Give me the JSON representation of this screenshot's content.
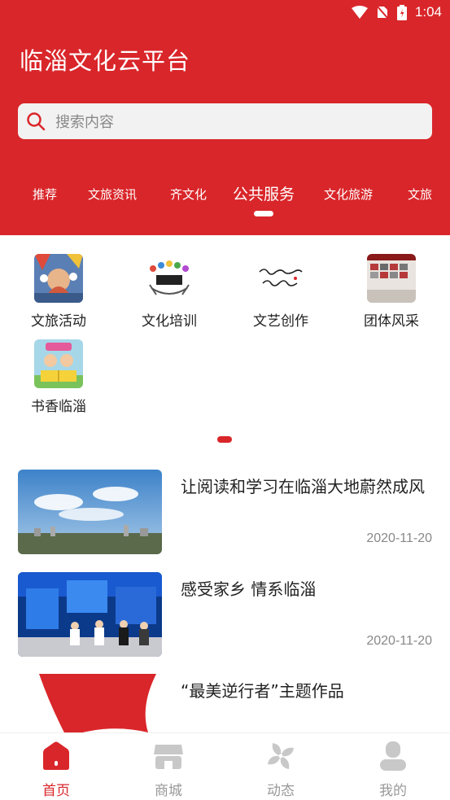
{
  "status": {
    "time": "1:04"
  },
  "app": {
    "title": "临淄文化云平台"
  },
  "search": {
    "placeholder": "搜索内容"
  },
  "tabs": [
    {
      "label": "推荐"
    },
    {
      "label": "文旅资讯"
    },
    {
      "label": "齐文化"
    },
    {
      "label": "公共服务",
      "active": true
    },
    {
      "label": "文化旅游"
    },
    {
      "label": "文旅"
    }
  ],
  "services": [
    {
      "label": "文旅活动"
    },
    {
      "label": "文化培训"
    },
    {
      "label": "文艺创作"
    },
    {
      "label": "团体风采"
    },
    {
      "label": "书香临淄"
    }
  ],
  "news": [
    {
      "title": "让阅读和学习在临淄大地蔚然成风",
      "date": "2020-11-20"
    },
    {
      "title": "感受家乡 情系临淄",
      "date": "2020-11-20"
    },
    {
      "title": "“最美逆行者”主题作品",
      "date": ""
    }
  ],
  "bottom_nav": [
    {
      "label": "首页",
      "icon": "home-icon",
      "active": true
    },
    {
      "label": "商城",
      "icon": "store-icon"
    },
    {
      "label": "动态",
      "icon": "pinwheel-icon"
    },
    {
      "label": "我的",
      "icon": "user-icon"
    }
  ],
  "colors": {
    "brand": "#d9262a",
    "text": "#222222",
    "muted": "#888888"
  }
}
